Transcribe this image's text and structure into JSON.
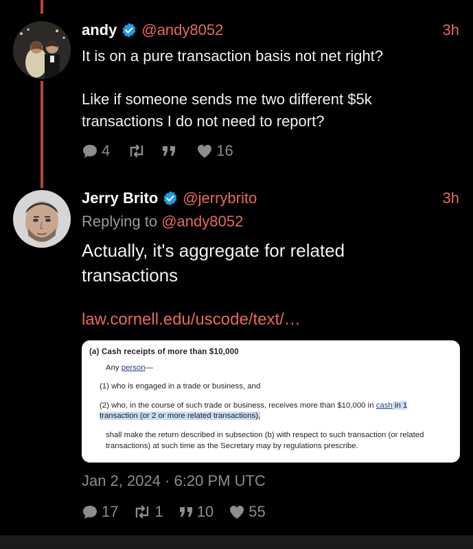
{
  "tweets": [
    {
      "name": "andy",
      "handle": "@andy8052",
      "time": "3h",
      "text_1": "It is on a pure transaction basis not net right?",
      "text_2": "Like if someone sends me two different $5k",
      "text_3": "transactions I do not need to report?",
      "replies": "4",
      "retweets": "",
      "quotes": "",
      "likes": "16"
    },
    {
      "name": "Jerry Brito",
      "handle": "@jerrybrito",
      "time": "3h",
      "replying_label": "Replying to",
      "replying_handle": "@andy8052",
      "text_1": "Actually, it's aggregate for related",
      "text_2": "transactions",
      "link": "law.cornell.edu/uscode/text/…",
      "date": "Jan 2, 2024 · 6:20 PM UTC",
      "replies": "17",
      "retweets": "1",
      "quotes": "10",
      "likes": "55"
    }
  ],
  "card": {
    "heading": "(a) Cash receipts of more than $10,000",
    "line1_pre": "Any ",
    "line1_link": "person",
    "line1_post": "—",
    "item1": "(1) who is engaged in a trade or business, and",
    "item2_pre": "(2) who, in the course of such trade or business, receives more than $10,000 in ",
    "item2_link": "cash",
    "item2_hl": " in 1",
    "item2_line2": "transaction (or 2 or more related transactions),",
    "tail1": "shall make the return described in subsection (b) with respect to such transaction (or related",
    "tail2": "transactions) at such time as the Secretary may by regulations prescribe."
  },
  "colors": {
    "accent": "#e86a5a",
    "thread": "#b5473f",
    "verified": "#1d9bf0",
    "muted": "#8d8d8d"
  },
  "icons": [
    "verified-badge-icon",
    "reply-icon",
    "retweet-icon",
    "quote-icon",
    "heart-icon"
  ]
}
